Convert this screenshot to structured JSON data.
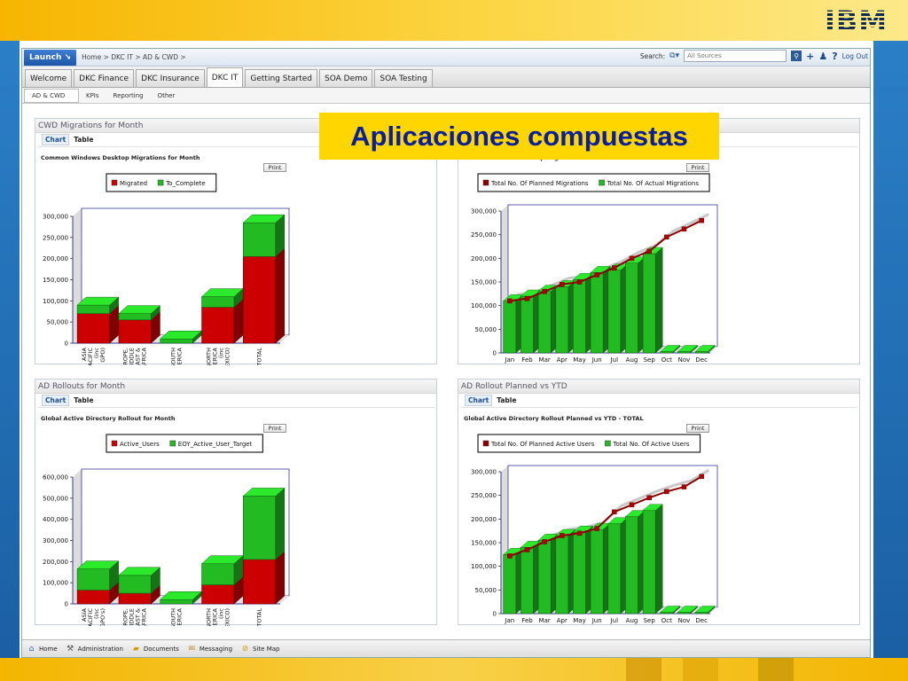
{
  "slide": {
    "logo_text": "IBM",
    "overlay_title": "Aplicaciones compuestas",
    "colors": {
      "top_band": "#f7b500",
      "side_band": "#2a7fc7",
      "overlay_bg": "#ffd600",
      "overlay_text": "#0a1f9e"
    }
  },
  "topbar": {
    "launch_label": "Launch",
    "breadcrumb": "Home > DKC IT > AD & CWD >",
    "search_label": "Search:",
    "search_placeholder": "All Sources",
    "logout_label": "Log Out"
  },
  "tabs": [
    {
      "label": "Welcome"
    },
    {
      "label": "DKC Finance"
    },
    {
      "label": "DKC Insurance"
    },
    {
      "label": "DKC IT",
      "active": true
    },
    {
      "label": "Getting Started"
    },
    {
      "label": "SOA Demo"
    },
    {
      "label": "SOA Testing"
    }
  ],
  "subtabs": [
    {
      "label": "AD & CWD",
      "active": true
    },
    {
      "label": "KPIs"
    },
    {
      "label": "Reporting"
    },
    {
      "label": "Other"
    }
  ],
  "portlets": [
    {
      "header": "CWD Migrations for Month",
      "tab_chart": "Chart",
      "tab_table": "Table",
      "chart_title": "Common Windows Desktop Migrations for Month",
      "print_label": "Print"
    },
    {
      "header": "",
      "tab_chart": "",
      "tab_table": "",
      "chart_title": "Global Windows Desktop Migrations Planned vs YTD - TOTAL",
      "print_label": "Print"
    },
    {
      "header": "AD Rollouts for Month",
      "tab_chart": "Chart",
      "tab_table": "Table",
      "chart_title": "Global Active Directory Rollout for Month",
      "print_label": "Print"
    },
    {
      "header": "AD Rollout Planned vs YTD",
      "tab_chart": "Chart",
      "tab_table": "Table",
      "chart_title": "Global Active Directory Rollout Planned vs YTD - TOTAL",
      "print_label": "Print"
    }
  ],
  "bottombar": [
    {
      "label": "Home",
      "icon": "home-icon"
    },
    {
      "label": "Administration",
      "icon": "wrench-icon"
    },
    {
      "label": "Documents",
      "icon": "folder-icon"
    },
    {
      "label": "Messaging",
      "icon": "inbox-icon"
    },
    {
      "label": "Site Map",
      "icon": "compass-icon"
    }
  ],
  "chart_data": [
    {
      "type": "bar",
      "stacked": true,
      "categories": [
        "ASIA PACIFIC (inc GPO)",
        "EUROPE, MIDDLE EAST & AFRICA",
        "SOUTH AMERICA",
        "NORTH AMERICA (inc MEXICO)",
        "TOTAL"
      ],
      "series": [
        {
          "name": "Migrated",
          "color": "#cc0000",
          "values": [
            70000,
            55000,
            0,
            85000,
            205000
          ]
        },
        {
          "name": "To_Complete",
          "color": "#22bb22",
          "values": [
            20000,
            15000,
            10000,
            25000,
            80000
          ]
        }
      ],
      "ylim": [
        0,
        300000
      ],
      "yticks": [
        "0",
        "50,000",
        "100,000",
        "150,000",
        "200,000",
        "250,000",
        "300,000"
      ],
      "legend": "top"
    },
    {
      "type": "bar+line",
      "categories": [
        "Jan",
        "Feb",
        "Mar",
        "Apr",
        "May",
        "Jun",
        "Jul",
        "Aug",
        "Sep",
        "Oct",
        "Nov",
        "Dec"
      ],
      "series": [
        {
          "name": "Total No. Of Planned Migrations",
          "kind": "line",
          "color": "#8b0000",
          "values": [
            110000,
            115000,
            130000,
            145000,
            150000,
            165000,
            180000,
            200000,
            215000,
            245000,
            262000,
            280000
          ]
        },
        {
          "name": "Total No. Of Actual Migrations",
          "kind": "bar",
          "color": "#22bb22",
          "values": [
            110000,
            120000,
            130000,
            140000,
            155000,
            170000,
            175000,
            190000,
            210000,
            0,
            0,
            0
          ]
        }
      ],
      "ylim": [
        0,
        300000
      ],
      "yticks": [
        "0",
        "50,000",
        "100,000",
        "150,000",
        "200,000",
        "250,000",
        "300,000"
      ],
      "legend": "top"
    },
    {
      "type": "bar",
      "stacked": true,
      "categories": [
        "ASIA PACIFIC (inc GPO's)",
        "EUROPE, MIDDLE EAST & AFRICA",
        "SOUTH AMERICA",
        "NORTH AMERICA (inc MEXICO)",
        "TOTAL"
      ],
      "series": [
        {
          "name": "Active_Users",
          "color": "#cc0000",
          "values": [
            65000,
            50000,
            0,
            90000,
            210000
          ]
        },
        {
          "name": "EOY_Active_User_Target",
          "color": "#22bb22",
          "values": [
            100000,
            85000,
            20000,
            100000,
            300000
          ]
        }
      ],
      "ylim": [
        0,
        600000
      ],
      "yticks": [
        "0",
        "100,000",
        "200,000",
        "300,000",
        "400,000",
        "500,000",
        "600,000"
      ],
      "legend": "top"
    },
    {
      "type": "bar+line",
      "categories": [
        "Jan",
        "Feb",
        "Mar",
        "Apr",
        "May",
        "Jun",
        "Jul",
        "Aug",
        "Sep",
        "Oct",
        "Nov",
        "Dec"
      ],
      "series": [
        {
          "name": "Total No. Of Planned Active Users",
          "kind": "line",
          "color": "#8b0000",
          "values": [
            122000,
            135000,
            152000,
            165000,
            170000,
            180000,
            215000,
            230000,
            245000,
            258000,
            268000,
            290000
          ]
        },
        {
          "name": "Total No. Of Active Users",
          "kind": "bar",
          "color": "#22bb22",
          "values": [
            125000,
            140000,
            155000,
            165000,
            172000,
            178000,
            190000,
            205000,
            218000,
            0,
            0,
            0
          ]
        }
      ],
      "ylim": [
        0,
        300000
      ],
      "yticks": [
        "0",
        "50,000",
        "100,000",
        "150,000",
        "200,000",
        "250,000",
        "300,000"
      ],
      "legend": "top"
    }
  ]
}
